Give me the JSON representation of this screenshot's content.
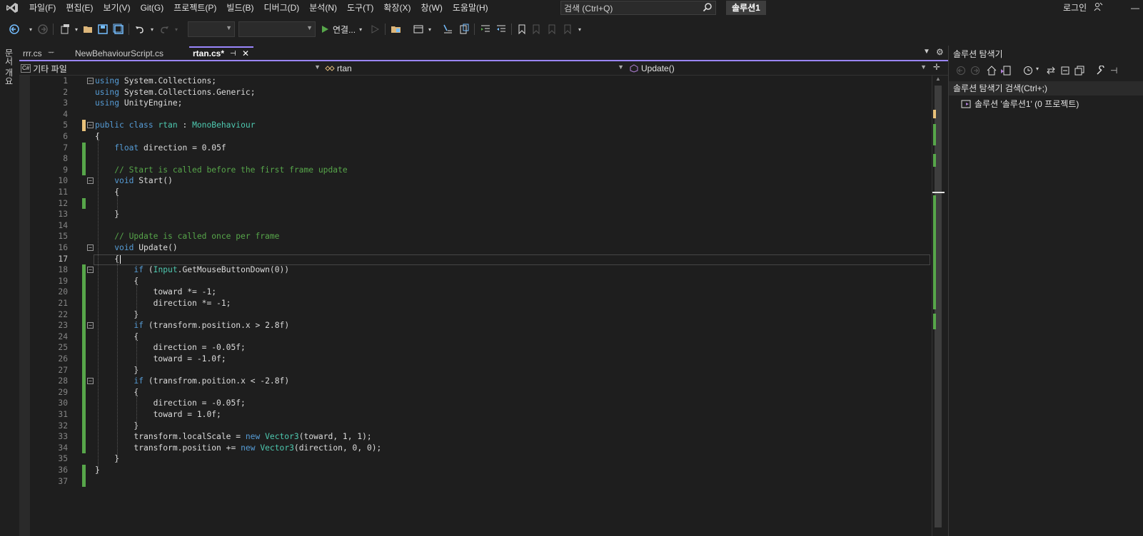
{
  "colors": {
    "accent": "#9a86fd",
    "keyword": "#569cd6",
    "comment": "#57a64a",
    "change_bar": "#57a64a",
    "background": "#1e1e1e"
  },
  "menubar": {
    "items": [
      "파일(F)",
      "편집(E)",
      "보기(V)",
      "Git(G)",
      "프로젝트(P)",
      "빌드(B)",
      "디버그(D)",
      "분석(N)",
      "도구(T)",
      "확장(X)",
      "창(W)",
      "도움말(H)"
    ],
    "search_placeholder": "검색 (Ctrl+Q)",
    "solution_name": "솔루션1",
    "login": "로그인",
    "minimize": "—"
  },
  "toolbar": {
    "run_label": "연결..."
  },
  "left_strip": {
    "label": "문서 개요"
  },
  "tabs": [
    {
      "label": "rrr.cs",
      "pin": "ᅲ"
    },
    {
      "label": "NewBehaviourScript.cs"
    },
    {
      "label": "rtan.cs*",
      "pin": "⊣",
      "close": "✕"
    }
  ],
  "navbar": {
    "project": "기타 파일",
    "class": "rtan",
    "member": "Update()"
  },
  "editor": {
    "current_line": 17,
    "lines": [
      "using System.Collections;",
      "using System.Collections.Generic;",
      "using UnityEngine;",
      "",
      "public class rtan : MonoBehaviour",
      "{",
      "    float direction = 0.05f",
      "",
      "    // Start is called before the first frame update",
      "    void Start()",
      "    {",
      "",
      "    }",
      "",
      "    // Update is called once per frame",
      "    void Update()",
      "    {",
      "        if (Input.GetMouseButtonDown(0))",
      "        {",
      "            toward *= -1;",
      "            direction *= -1;",
      "        }",
      "        if (transform.position.x > 2.8f)",
      "        {",
      "            direction = -0.05f;",
      "            toward = -1.0f;",
      "        }",
      "        if (transfrom.poition.x < -2.8f)",
      "        {",
      "            direction = -0.05f;",
      "            toward = 1.0f;",
      "        }",
      "        transform.localScale = new Vector3(toward, 1, 1);",
      "        transform.position += new Vector3(direction, 0, 0);",
      "    }",
      "}",
      ""
    ]
  },
  "solution_explorer": {
    "title": "솔루션 탐색기",
    "search_label": "솔루션 탐색기 검색(Ctrl+;)",
    "item": "솔루션 '솔루션1' (0 프로젝트)"
  }
}
